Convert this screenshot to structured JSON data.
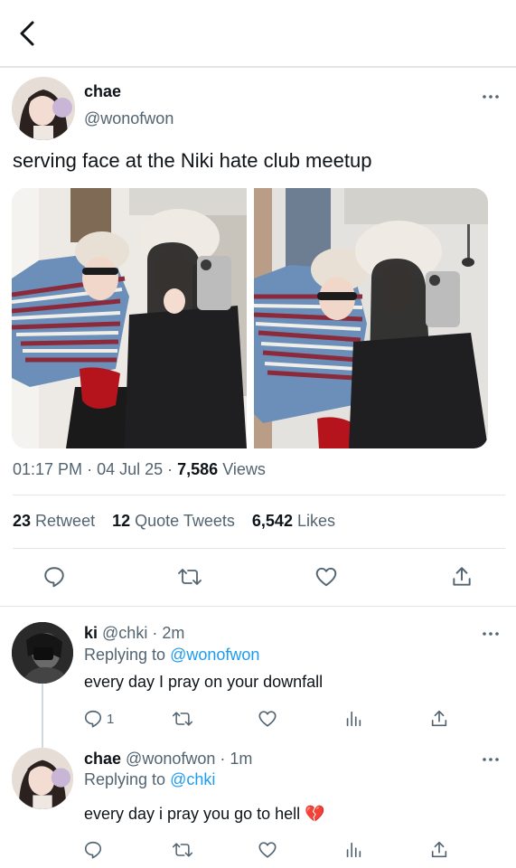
{
  "header": {
    "back_icon": "chevron-left-icon"
  },
  "tweet": {
    "author_name": "chae",
    "author_handle": "@wonofwon",
    "text": "serving face at the Niki hate club meetup",
    "time": "01:17 PM",
    "date": "04 Jul 25",
    "views_count": "7,586",
    "views_label": "Views",
    "retweet_count": "23",
    "retweet_label": "Retweet",
    "quote_count": "12",
    "quote_label": "Quote Tweets",
    "likes_count": "6,542",
    "likes_label": "Likes",
    "actions": [
      "reply-icon",
      "retweet-icon",
      "like-icon",
      "share-icon"
    ]
  },
  "replies": [
    {
      "name": "ki",
      "handle": "@chki",
      "age": "2m",
      "replying_prefix": "Replying to",
      "replying_to": "@wonofwon",
      "text": "every day I pray on your downfall",
      "reply_count": "1"
    },
    {
      "name": "chae",
      "handle": "@wonofwon",
      "age": "1m",
      "replying_prefix": "Replying to",
      "replying_to": "@chki",
      "text": "every day i pray you go to hell",
      "emoji": "💔"
    }
  ],
  "colors": {
    "accent": "#1d9bf0",
    "text": "#0f1419",
    "muted": "#536471",
    "divider": "#e3e6e8"
  }
}
